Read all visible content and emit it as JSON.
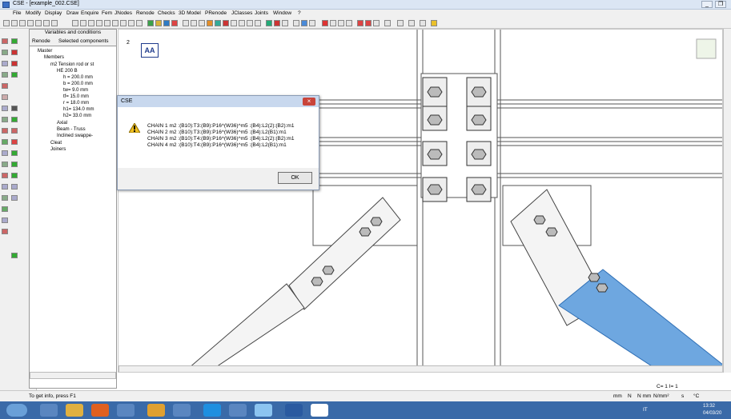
{
  "window": {
    "title": "CSE - [example_002.CSE]",
    "minimize": "_",
    "restore": "❐"
  },
  "menu": [
    "File",
    "Modify",
    "Display",
    "Draw",
    "Enquire",
    "Fem",
    "JNodes",
    "Renode",
    "Checks",
    "3D Model",
    "PRenode",
    "JClasses",
    "Joints",
    "Window",
    "?"
  ],
  "panel": {
    "header": "Variables and conditions",
    "tabs": [
      "Renode",
      "Selected components"
    ],
    "tree": [
      "Master",
      "Members",
      "m2 Tension rod or st",
      "HE 200 B",
      "h = 200.0 mm",
      "b = 200.0 mm",
      "tw= 9.0 mm",
      "tf= 15.0 mm",
      "r = 18.0 mm",
      "h1= 134.0 mm",
      "h2= 33.0 mm",
      "Axial",
      "Beam - Truss",
      "Inclined swappe-",
      "Cleat",
      "Joiners"
    ]
  },
  "canvas": {
    "view_badge": "AA",
    "axis_label": "2"
  },
  "dialog": {
    "title": "CSE",
    "close": "×",
    "ok": "OK",
    "lines": [
      "CHAIN 1  m2 :(B10):T3:(B9):P16^(W36)^m5 :(B4):L2(2):(B2):m1",
      "CHAIN 2  m2 :(B10):T3:(B9):P16^(W36)^m5 :(B4):L2(B1):m1",
      "CHAIN 3  m2 :(B10):T4:(B9):P16^(W36)^m5 :(B4):L2(2):(B2):m1",
      "CHAIN 4  m2 :(B10):T4:(B9):P16^(W36)^m5 :(B4):L2(B1):m1"
    ]
  },
  "coords": "C= 1   I= 1",
  "status": {
    "hint": "To get info, press F1",
    "units": [
      "mm",
      "N",
      "N mm",
      "N/mm²",
      "s",
      "°C"
    ]
  },
  "taskbar": {
    "lang": "IT",
    "time": "13:32",
    "date": "04/03/20"
  },
  "colors": {
    "plate": "#6ea7e0",
    "accent": "#3b6fc4"
  }
}
